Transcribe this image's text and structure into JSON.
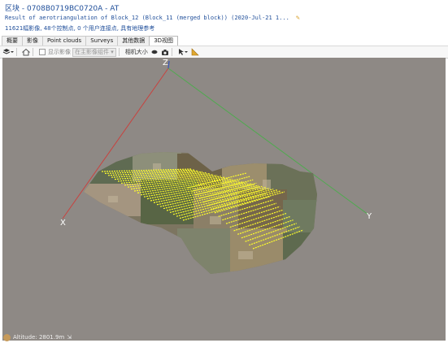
{
  "header": {
    "title": "区块 - 0708B0719BC0720A - AT",
    "subtitle": "Result of aerotriangulation of Block_12 (Block_11 (merged block)) (2020-Jul-21 1...",
    "edit_icon": "pencil-icon",
    "description": "11621幅影像, 48个控制点, 0 个用户连接点, 具有地理参考"
  },
  "tabs": [
    {
      "label": "概要",
      "active": false
    },
    {
      "label": "影像",
      "active": false
    },
    {
      "label": "Point clouds",
      "active": false
    },
    {
      "label": "Surveys",
      "active": false
    },
    {
      "label": "其他数据",
      "active": false
    },
    {
      "label": "3D视图",
      "active": true
    }
  ],
  "toolbar": {
    "layers_icon": "layers-icon",
    "home_icon": "home-icon",
    "show_images_label": "显示影像",
    "photo_group_select": "在主影像组件",
    "camera_size_label": "相机大小",
    "camera_icon": "camera-icon",
    "screenshot_icon": "screenshot-icon",
    "pointer_icon": "pointer-icon",
    "measure_icon": "ruler-icon"
  },
  "viewport": {
    "background": "#8e8985",
    "axes": [
      {
        "label": "X",
        "color": "#d24a4a"
      },
      {
        "label": "Y",
        "color": "#4faa4f"
      },
      {
        "label": "Z",
        "color": "#3a56b8"
      }
    ],
    "camera_color": "#ffff2a"
  },
  "status": {
    "altitude": "Altitude: 2801.9m"
  }
}
